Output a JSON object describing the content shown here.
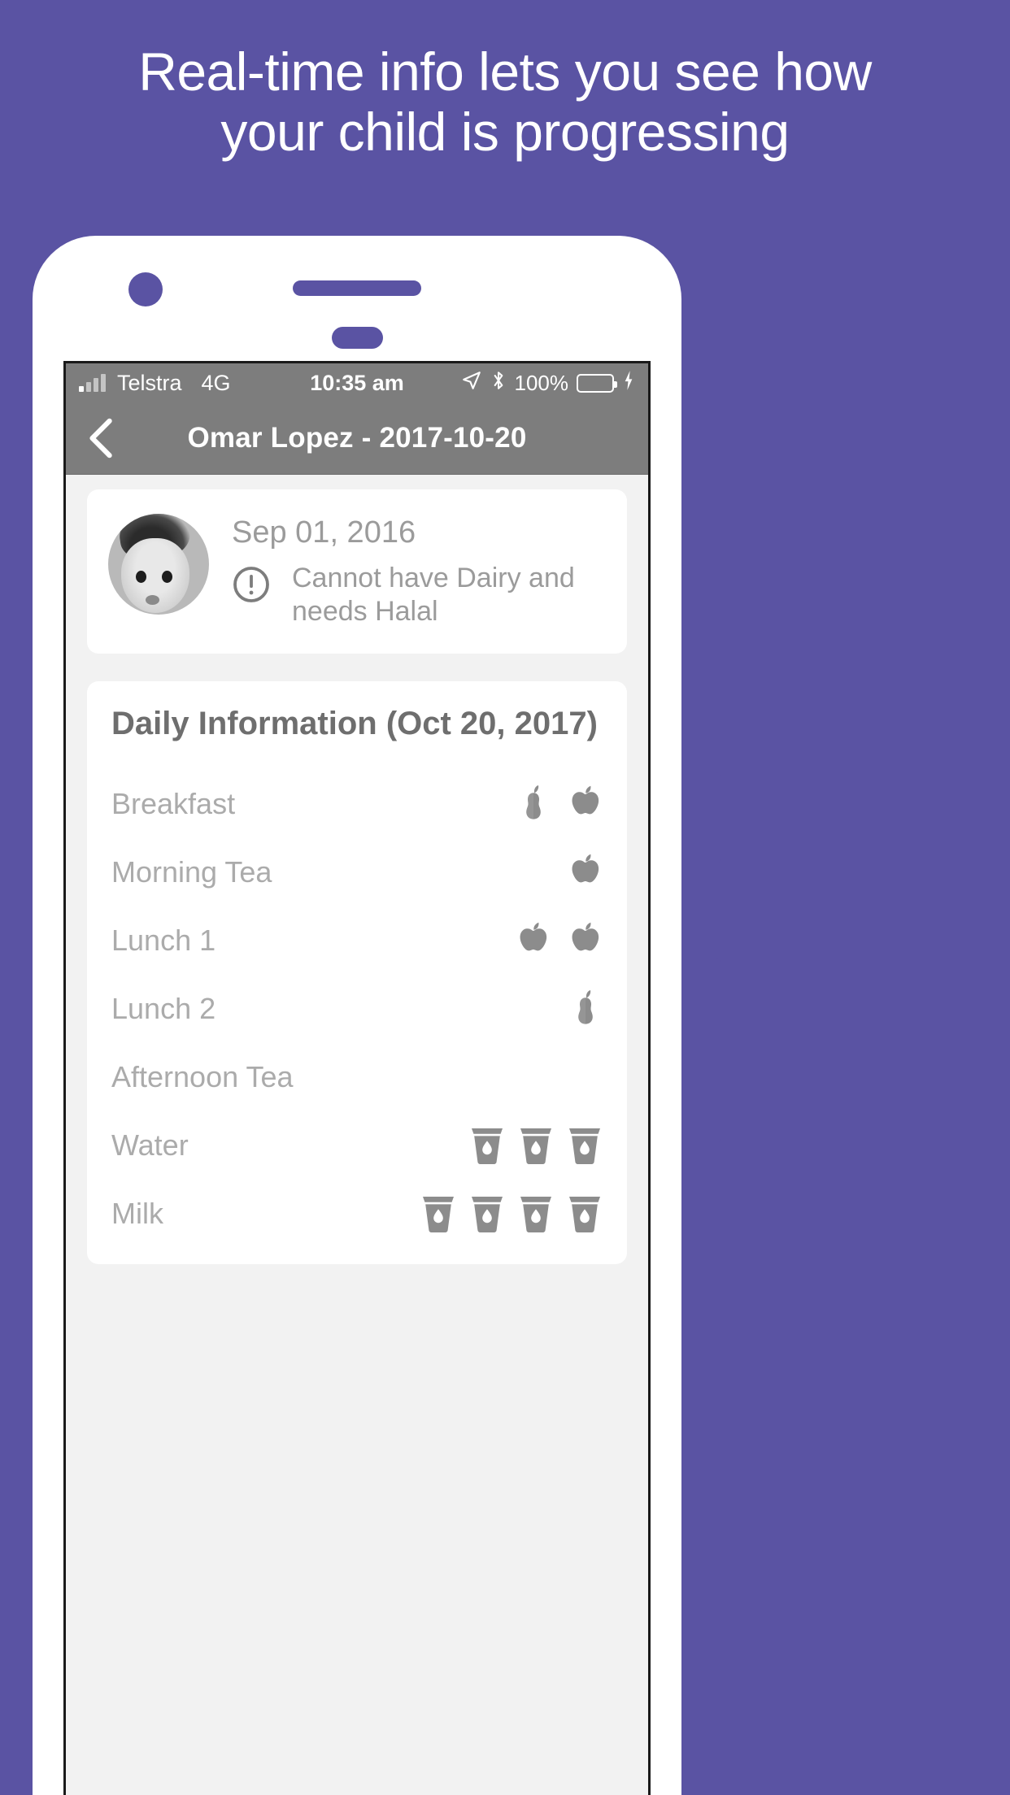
{
  "promo": {
    "headline_line1": "Real-time info lets you see how",
    "headline_line2": "your child is progressing",
    "background_color": "#5a53a3"
  },
  "statusbar": {
    "carrier": "Telstra",
    "network": "4G",
    "time": "10:35 am",
    "battery_percent": "100%",
    "icons": {
      "signal": "signal-bars-icon",
      "location": "location-arrow-icon",
      "bluetooth": "bluetooth-icon",
      "battery": "battery-icon",
      "charging": "charging-bolt-icon"
    }
  },
  "navbar": {
    "back_label": "back-chevron",
    "title": "Omar Lopez - 2017-10-20"
  },
  "profile": {
    "date_of_birth": "Sep 01, 2016",
    "alert_icon": "exclamation-circle-icon",
    "alert_text": "Cannot have Dairy and needs Halal",
    "avatar": "child-avatar"
  },
  "daily": {
    "title": "Daily Information (Oct 20, 2017)",
    "rows": [
      {
        "label": "Breakfast",
        "icons": [
          "pear",
          "apple"
        ]
      },
      {
        "label": "Morning Tea",
        "icons": [
          "apple"
        ]
      },
      {
        "label": "Lunch 1",
        "icons": [
          "apple",
          "apple"
        ]
      },
      {
        "label": "Lunch 2",
        "icons": [
          "pear"
        ]
      },
      {
        "label": "Afternoon Tea",
        "icons": []
      },
      {
        "label": "Water",
        "icons": [
          "glass",
          "glass",
          "glass"
        ]
      },
      {
        "label": "Milk",
        "icons": [
          "glass",
          "glass",
          "glass",
          "glass"
        ]
      }
    ]
  },
  "colors": {
    "brand_purple": "#5a53a3",
    "bar_gray": "#7d7d7d",
    "text_gray": "#9b9b9b",
    "label_gray": "#ababab",
    "screen_bg": "#f2f2f2"
  }
}
